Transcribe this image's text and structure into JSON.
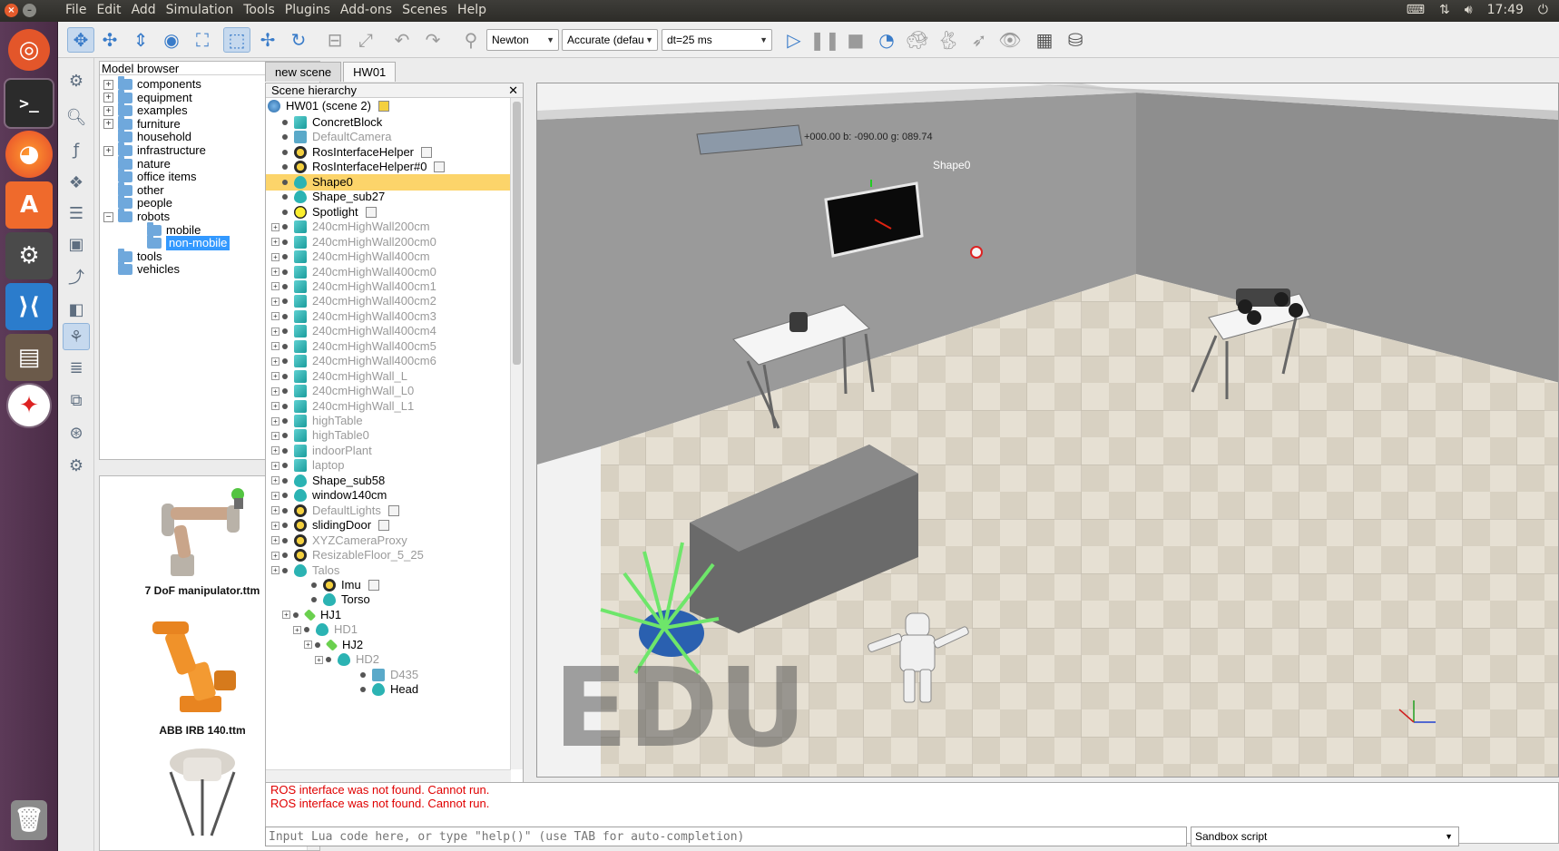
{
  "topbar": {
    "menu": [
      "File",
      "Edit",
      "Add",
      "Simulation",
      "Tools",
      "Plugins",
      "Add-ons",
      "Scenes",
      "Help"
    ],
    "clock": "17:49"
  },
  "toolbar": {
    "engine": "Newton",
    "accuracy": "Accurate (defau",
    "dt": "dt=25 ms"
  },
  "model_browser": {
    "title": "Model browser",
    "items": [
      {
        "label": "components",
        "expander": "+"
      },
      {
        "label": "equipment",
        "expander": "+"
      },
      {
        "label": "examples",
        "expander": "+"
      },
      {
        "label": "furniture",
        "expander": "+"
      },
      {
        "label": "household",
        "expander": ""
      },
      {
        "label": "infrastructure",
        "expander": "+"
      },
      {
        "label": "nature",
        "expander": ""
      },
      {
        "label": "office items",
        "expander": ""
      },
      {
        "label": "other",
        "expander": ""
      },
      {
        "label": "people",
        "expander": ""
      },
      {
        "label": "robots",
        "expander": "−"
      },
      {
        "label": "mobile",
        "expander": ""
      },
      {
        "label": "non-mobile",
        "expander": ""
      },
      {
        "label": "tools",
        "expander": ""
      },
      {
        "label": "vehicles",
        "expander": ""
      }
    ],
    "thumbnails": [
      "7 DoF manipulator.ttm",
      "ABB IRB 140.ttm"
    ]
  },
  "scene_tabs": [
    "new scene",
    "HW01"
  ],
  "scene_hierarchy": {
    "title": "Scene hierarchy",
    "root": "HW01 (scene 2)",
    "rows": [
      {
        "name": "ConcretBlock",
        "icon": "shape",
        "dim": false,
        "exp": false,
        "script": false
      },
      {
        "name": "DefaultCamera",
        "icon": "cam",
        "dim": true,
        "exp": false,
        "script": false
      },
      {
        "name": "RosInterfaceHelper",
        "icon": "script",
        "dim": false,
        "exp": false,
        "script": true
      },
      {
        "name": "RosInterfaceHelper#0",
        "icon": "script",
        "dim": false,
        "exp": false,
        "script": true
      },
      {
        "name": "Shape0",
        "icon": "drop",
        "dim": false,
        "exp": false,
        "script": false,
        "selected": true
      },
      {
        "name": "Shape_sub27",
        "icon": "drop",
        "dim": false,
        "exp": false,
        "script": false
      },
      {
        "name": "Spotlight",
        "icon": "light",
        "dim": false,
        "exp": false,
        "script": true
      },
      {
        "name": "240cmHighWall200cm",
        "icon": "shape",
        "dim": true,
        "exp": true,
        "script": false
      },
      {
        "name": "240cmHighWall200cm0",
        "icon": "shape",
        "dim": true,
        "exp": true,
        "script": false
      },
      {
        "name": "240cmHighWall400cm",
        "icon": "shape",
        "dim": true,
        "exp": true,
        "script": false
      },
      {
        "name": "240cmHighWall400cm0",
        "icon": "shape",
        "dim": true,
        "exp": true,
        "script": false
      },
      {
        "name": "240cmHighWall400cm1",
        "icon": "shape",
        "dim": true,
        "exp": true,
        "script": false
      },
      {
        "name": "240cmHighWall400cm2",
        "icon": "shape",
        "dim": true,
        "exp": true,
        "script": false
      },
      {
        "name": "240cmHighWall400cm3",
        "icon": "shape",
        "dim": true,
        "exp": true,
        "script": false
      },
      {
        "name": "240cmHighWall400cm4",
        "icon": "shape",
        "dim": true,
        "exp": true,
        "script": false
      },
      {
        "name": "240cmHighWall400cm5",
        "icon": "shape",
        "dim": true,
        "exp": true,
        "script": false
      },
      {
        "name": "240cmHighWall400cm6",
        "icon": "shape",
        "dim": true,
        "exp": true,
        "script": false
      },
      {
        "name": "240cmHighWall_L",
        "icon": "shape",
        "dim": true,
        "exp": true,
        "script": false
      },
      {
        "name": "240cmHighWall_L0",
        "icon": "shape",
        "dim": true,
        "exp": true,
        "script": false
      },
      {
        "name": "240cmHighWall_L1",
        "icon": "shape",
        "dim": true,
        "exp": true,
        "script": false
      },
      {
        "name": "highTable",
        "icon": "shape",
        "dim": true,
        "exp": true,
        "script": false
      },
      {
        "name": "highTable0",
        "icon": "shape",
        "dim": true,
        "exp": true,
        "script": false
      },
      {
        "name": "indoorPlant",
        "icon": "shape",
        "dim": true,
        "exp": true,
        "script": false
      },
      {
        "name": "laptop",
        "icon": "shape",
        "dim": true,
        "exp": true,
        "script": false
      },
      {
        "name": "Shape_sub58",
        "icon": "drop",
        "dim": false,
        "exp": true,
        "script": false
      },
      {
        "name": "window140cm",
        "icon": "drop",
        "dim": false,
        "exp": true,
        "script": false
      },
      {
        "name": "DefaultLights",
        "icon": "script",
        "dim": true,
        "exp": true,
        "script": true
      },
      {
        "name": "slidingDoor",
        "icon": "script",
        "dim": false,
        "exp": true,
        "script": true
      },
      {
        "name": "XYZCameraProxy",
        "icon": "script",
        "dim": true,
        "exp": true,
        "script": false
      },
      {
        "name": "ResizableFloor_5_25",
        "icon": "script",
        "dim": true,
        "exp": true,
        "script": false
      },
      {
        "name": "Talos",
        "icon": "drop",
        "dim": true,
        "exp": true,
        "script": false
      },
      {
        "name": "Imu",
        "icon": "script",
        "dim": false,
        "exp": false,
        "script": true
      },
      {
        "name": "Torso",
        "icon": "drop",
        "dim": false,
        "exp": false,
        "script": false
      },
      {
        "name": "HJ1",
        "icon": "joint",
        "dim": false,
        "exp": true,
        "script": false
      },
      {
        "name": "HD1",
        "icon": "drop",
        "dim": true,
        "exp": true,
        "script": false
      },
      {
        "name": "HJ2",
        "icon": "joint",
        "dim": false,
        "exp": true,
        "script": false
      },
      {
        "name": "HD2",
        "icon": "drop",
        "dim": true,
        "exp": true,
        "script": false
      },
      {
        "name": "D435",
        "icon": "cam",
        "dim": true,
        "exp": false,
        "script": false
      },
      {
        "name": "Head",
        "icon": "drop",
        "dim": false,
        "exp": false,
        "script": false
      }
    ]
  },
  "viewport": {
    "coords": "+000.00   b: -090.00   g: 089.74",
    "shape_label": "Shape0",
    "watermark": "EDU"
  },
  "console": {
    "errors": [
      "ROS interface was not found. Cannot run.",
      "ROS interface was not found. Cannot run."
    ]
  },
  "command": {
    "placeholder": "Input Lua code here, or type \"help()\" (use TAB for auto-completion)",
    "sandbox": "Sandbox script"
  }
}
